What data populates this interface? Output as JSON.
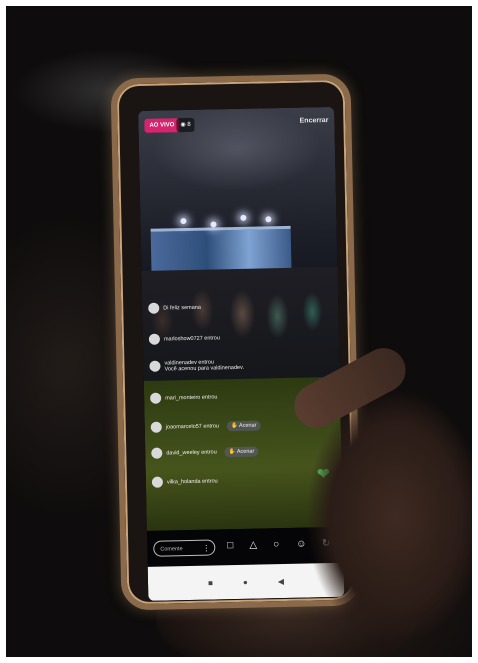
{
  "live": {
    "badge": "AO VIVO",
    "viewers": "8",
    "end_button": "Encerrar"
  },
  "comments": [
    {
      "user": "",
      "text": "Di feliz semana",
      "button": ""
    },
    {
      "user": "marloshow0727 entrou",
      "text": "",
      "button": ""
    },
    {
      "user": "valdinenadev entrou",
      "text": "Você acenou para valdinenadev.",
      "button": ""
    },
    {
      "user": "mari_monteiro entrou",
      "text": "",
      "button": ""
    },
    {
      "user": "joaomarcelo57 entrou",
      "text": "",
      "button": "Acenar"
    },
    {
      "user": "david_weeley entrou",
      "text": "",
      "button": "Acenar"
    },
    {
      "user": "vilka_holanda entrou",
      "text": "",
      "button": ""
    }
  ],
  "bottom_bar": {
    "comment_placeholder": "Comente"
  },
  "colors": {
    "live_badge": "#d6246e",
    "heart": "#5fd16a"
  },
  "icons": [
    "question-icon",
    "send-icon",
    "share-users-icon",
    "add-face-icon",
    "flip-camera-icon",
    "heart-icon"
  ]
}
